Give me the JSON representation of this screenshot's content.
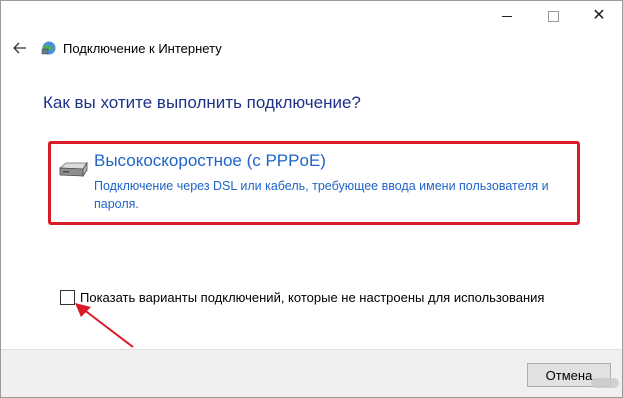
{
  "window": {
    "title": "Подключение к Интернету"
  },
  "main": {
    "heading": "Как вы хотите выполнить подключение?",
    "option": {
      "title": "Высокоскоростное (с PPPoE)",
      "description": "Подключение через DSL или кабель, требующее ввода имени пользователя и пароля.",
      "highlight_color": "#d81b27",
      "icon": "modem-icon"
    },
    "show_all_checkbox": {
      "label": "Показать варианты подключений, которые не настроены для использования",
      "checked": false
    }
  },
  "footer": {
    "cancel_label": "Отмена"
  },
  "colors": {
    "heading": "#1e3287",
    "link": "#1e64c8",
    "annotation": "#d81b27"
  }
}
